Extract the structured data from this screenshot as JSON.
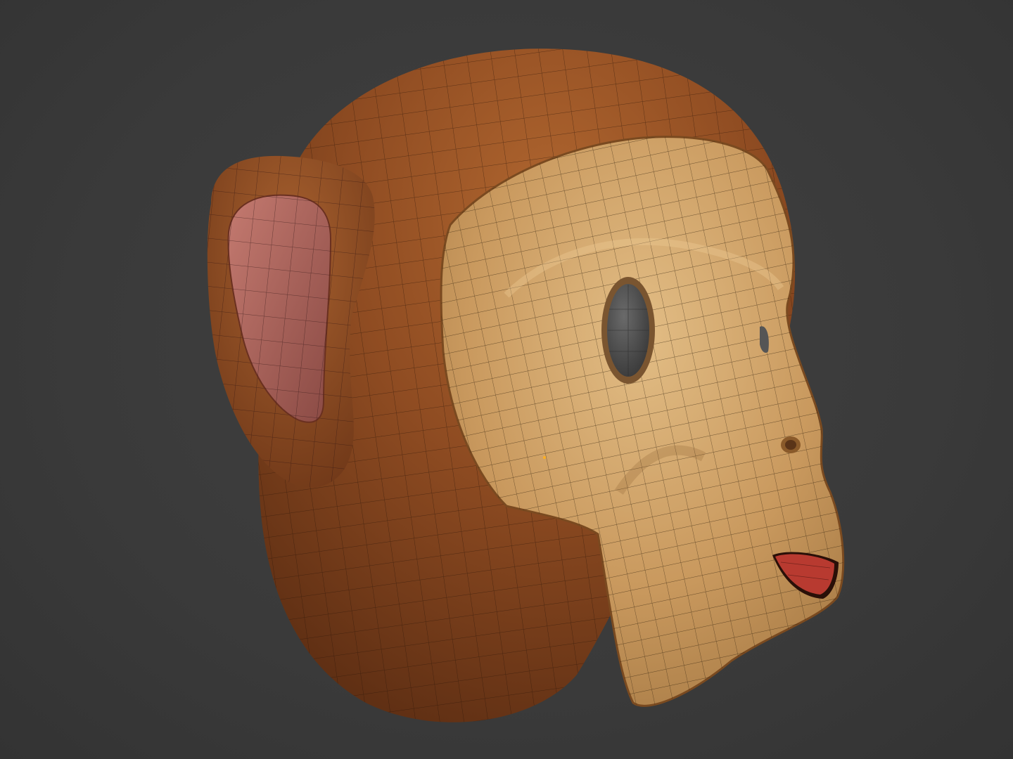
{
  "scene": {
    "subject": "monkey-head-3d-model",
    "view": "three-quarter-right",
    "shading": "solid-with-wireframe"
  },
  "colors": {
    "background": "#3b3b3b",
    "fur": "#8a4a22",
    "fur_light": "#a8612f",
    "fur_dark": "#5a2c12",
    "face": "#c99a60",
    "face_light": "#e0b980",
    "face_dark": "#9a6f3e",
    "inner_ear": "#b66a62",
    "eye": "#555555",
    "mouth": "#b83a30",
    "wire": "#1e1208"
  }
}
